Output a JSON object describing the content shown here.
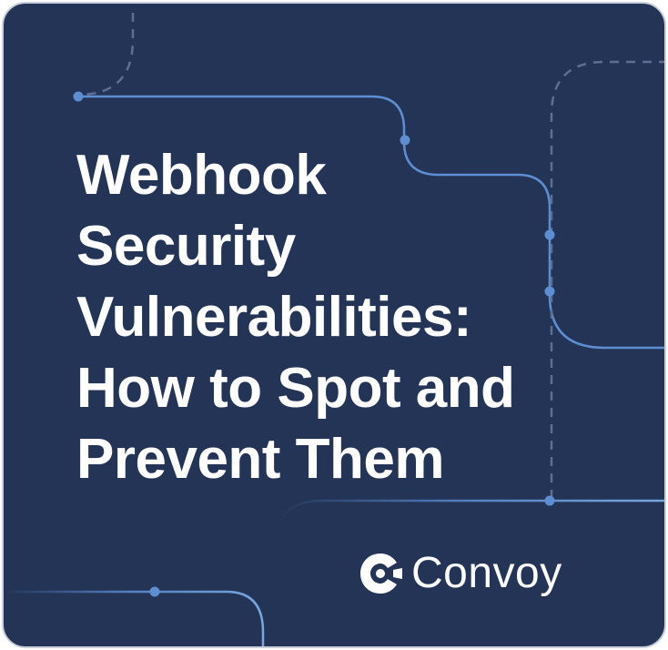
{
  "card": {
    "title_lines": [
      "Webhook",
      "Security",
      "Vulnerabilities:",
      "How to Spot and",
      "Prevent Them"
    ]
  },
  "brand": {
    "name": "Convoy",
    "icon": "convoy-logo-icon"
  },
  "colors": {
    "background": "#243457",
    "accent_line": "#4f7fc0",
    "text": "#ffffff"
  }
}
